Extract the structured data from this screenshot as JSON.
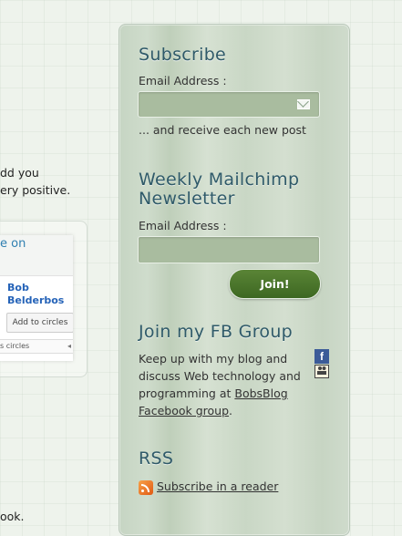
{
  "left": {
    "line1": "dd you",
    "line2": "ery positive.",
    "gplus_header": "e on",
    "gplus_name_line1": "Bob",
    "gplus_name_line2": "Belderbos",
    "gplus_button": "Add to circles",
    "gplus_footer": "s circles",
    "bottom_text": "ook."
  },
  "sidebar": {
    "subscribe": {
      "title": "Subscribe",
      "email_label": "Email Address :",
      "email_value": "",
      "note": "... and receive each new post"
    },
    "mailchimp": {
      "title_line1": "Weekly Mailchimp",
      "title_line2": "Newsletter",
      "email_label": "Email Address :",
      "email_value": "",
      "join_label": "Join!"
    },
    "fb_group": {
      "title": "Join my FB Group",
      "text_line1": "Keep up with my blog and",
      "text_line2": "discuss Web technology and",
      "text_line3_prefix": "programming at ",
      "link_line1": "BobsBlog",
      "link_line2": "Facebook group",
      "link_suffix": ".",
      "badge_letter": "f"
    },
    "rss": {
      "title": "RSS",
      "link": "Subscribe in a reader"
    }
  },
  "colors": {
    "title": "#2f5a69",
    "join_button": "#4a7a2c",
    "input_bg": "#a9bc9f",
    "facebook": "#3b5b98",
    "rss": "#f08a2c"
  },
  "icons": [
    "mail-icon",
    "facebook-icon",
    "people-icon",
    "rss-icon"
  ]
}
